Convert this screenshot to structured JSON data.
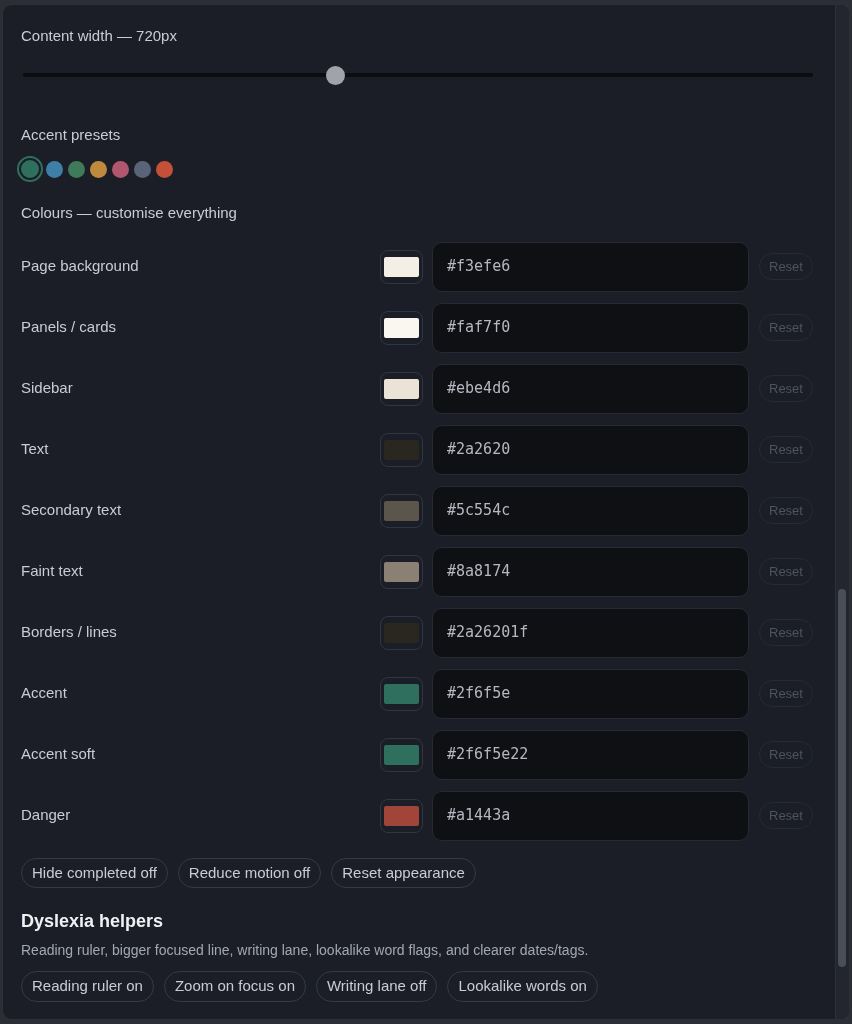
{
  "content_width": {
    "label": "Content width — 720px",
    "level": 0.395
  },
  "accent_presets": {
    "label": "Accent presets",
    "swatches": [
      {
        "color": "#2f6f5e",
        "selected": true
      },
      {
        "color": "#3e7fa8",
        "selected": false
      },
      {
        "color": "#3f7a5a",
        "selected": false
      },
      {
        "color": "#c08a3e",
        "selected": false
      },
      {
        "color": "#b0566e",
        "selected": false
      },
      {
        "color": "#5a6478",
        "selected": false
      },
      {
        "color": "#c4503a",
        "selected": false
      }
    ]
  },
  "colours": {
    "label": "Colours — customise everything",
    "rows": [
      {
        "name": "Page background",
        "value": "#f3efe6",
        "color": "#f3efe6",
        "reset": "Reset"
      },
      {
        "name": "Panels / cards",
        "value": "#faf7f0",
        "color": "#faf7f0",
        "reset": "Reset"
      },
      {
        "name": "Sidebar",
        "value": "#ebe4d6",
        "color": "#ebe4d6",
        "reset": "Reset"
      },
      {
        "name": "Text",
        "value": "#2a2620",
        "color": "#2a2620",
        "reset": "Reset"
      },
      {
        "name": "Secondary text",
        "value": "#5c554c",
        "color": "#5c554c",
        "reset": "Reset"
      },
      {
        "name": "Faint text",
        "value": "#8a8174",
        "color": "#8a8174",
        "reset": "Reset"
      },
      {
        "name": "Borders / lines",
        "value": "#2a26201f",
        "color": "#2a2620",
        "reset": "Reset"
      },
      {
        "name": "Accent",
        "value": "#2f6f5e",
        "color": "#2f6f5e",
        "reset": "Reset"
      },
      {
        "name": "Accent soft",
        "value": "#2f6f5e22",
        "color": "#2f6f5e",
        "reset": "Reset"
      },
      {
        "name": "Danger",
        "value": "#a1443a",
        "color": "#a1443a",
        "reset": "Reset"
      }
    ]
  },
  "appearance_buttons": [
    "Hide completed off",
    "Reduce motion off",
    "Reset appearance"
  ],
  "dyslexia": {
    "title": "Dyslexia helpers",
    "description": "Reading ruler, bigger focused line, writing lane, lookalike word flags, and clearer dates/tags.",
    "buttons": [
      "Reading ruler on",
      "Zoom on focus on",
      "Writing lane off",
      "Lookalike words on"
    ]
  }
}
